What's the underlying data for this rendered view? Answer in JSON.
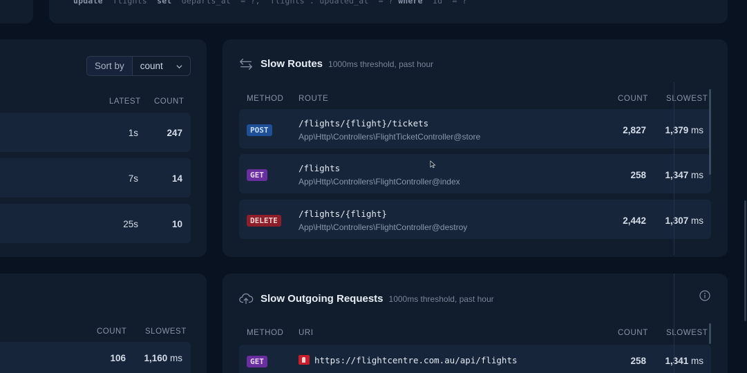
{
  "top": {
    "sql": {
      "kw1": "update",
      "t1": " `flights` ",
      "kw2": "set",
      "t2": " `departs_at` = ?, `flights`.`updated_at` = ? ",
      "kw3": "where",
      "t3": " `id` = ?"
    }
  },
  "left_panel": {
    "sort_label": "Sort by",
    "sort_value": "count",
    "headers": {
      "latest": "LATEST",
      "count": "COUNT"
    },
    "rows": [
      {
        "latest": "1s",
        "count": "247"
      },
      {
        "latest": "7s",
        "count": "14"
      },
      {
        "latest": "25s",
        "count": "10"
      }
    ]
  },
  "slow_routes": {
    "title": "Slow Routes",
    "subtitle": "1000ms threshold, past hour",
    "icon": "arrows-exchange-icon",
    "headers": {
      "method": "METHOD",
      "route": "ROUTE",
      "count": "COUNT",
      "slowest": "SLOWEST"
    },
    "rows": [
      {
        "method": "POST",
        "route": "/flights/{flight}/tickets",
        "action": "App\\Http\\Controllers\\FlightTicketController@store",
        "count": "2,827",
        "slowest": "1,379",
        "unit": "ms"
      },
      {
        "method": "GET",
        "route": "/flights",
        "action": "App\\Http\\Controllers\\FlightController@index",
        "count": "258",
        "slowest": "1,347",
        "unit": "ms"
      },
      {
        "method": "DELETE",
        "route": "/flights/{flight}",
        "action": "App\\Http\\Controllers\\FlightController@destroy",
        "count": "2,442",
        "slowest": "1,307",
        "unit": "ms"
      }
    ]
  },
  "left_bottom": {
    "headers": {
      "count": "COUNT",
      "slowest": "SLOWEST"
    },
    "rows": [
      {
        "count": "106",
        "slowest": "1,160",
        "unit": "ms"
      }
    ]
  },
  "slow_outgoing": {
    "title": "Slow Outgoing Requests",
    "subtitle": "1000ms threshold, past hour",
    "icon": "cloud-upload-icon",
    "info_icon": "info-icon",
    "headers": {
      "method": "METHOD",
      "uri": "URI",
      "count": "COUNT",
      "slowest": "SLOWEST"
    },
    "rows": [
      {
        "method": "GET",
        "uri": "https://flightcentre.com.au/api/flights",
        "count": "258",
        "slowest": "1,341",
        "unit": "ms"
      }
    ]
  },
  "colors": {
    "background": "#091220",
    "card": "#111d2d",
    "row": "#16253a",
    "post": "#1f4f97",
    "get": "#6a2f9f",
    "delete": "#8e1f2a"
  }
}
